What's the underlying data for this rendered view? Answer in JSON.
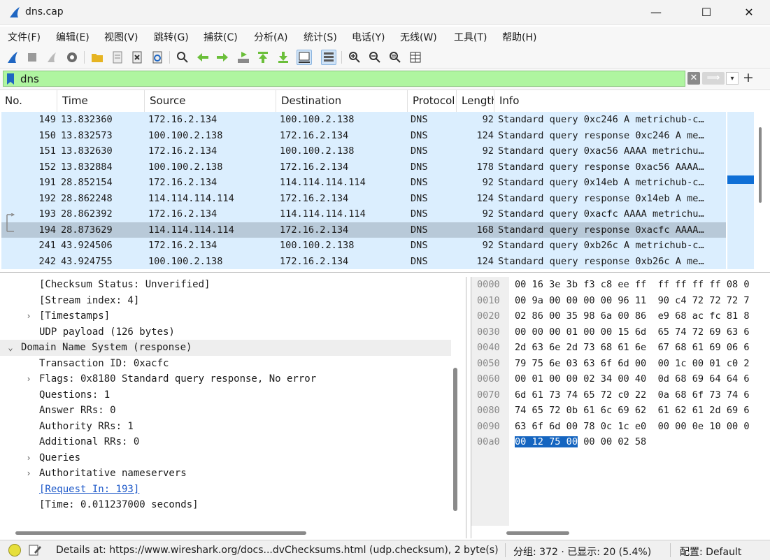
{
  "window": {
    "title": "dns.cap",
    "min": "—",
    "max": "☐",
    "close": "✕"
  },
  "menu": [
    "文件(F)",
    "编辑(E)",
    "视图(V)",
    "跳转(G)",
    "捕获(C)",
    "分析(A)",
    "统计(S)",
    "电话(Y)",
    "无线(W)",
    "工具(T)",
    "帮助(H)"
  ],
  "filter": {
    "value": "dns",
    "clear": "✕",
    "apply": "⟹",
    "dropdown": "▾",
    "add": "+"
  },
  "columns": [
    "No.",
    "Time",
    "Source",
    "Destination",
    "Protocol",
    "Length",
    "Info"
  ],
  "packets": [
    {
      "no": "149",
      "time": "13.832360",
      "src": "172.16.2.134",
      "dst": "100.100.2.138",
      "proto": "DNS",
      "len": "92",
      "info": "Standard query 0xc246 A metrichub-c…"
    },
    {
      "no": "150",
      "time": "13.832573",
      "src": "100.100.2.138",
      "dst": "172.16.2.134",
      "proto": "DNS",
      "len": "124",
      "info": "Standard query response 0xc246 A me…"
    },
    {
      "no": "151",
      "time": "13.832630",
      "src": "172.16.2.134",
      "dst": "100.100.2.138",
      "proto": "DNS",
      "len": "92",
      "info": "Standard query 0xac56 AAAA metrichu…"
    },
    {
      "no": "152",
      "time": "13.832884",
      "src": "100.100.2.138",
      "dst": "172.16.2.134",
      "proto": "DNS",
      "len": "178",
      "info": "Standard query response 0xac56 AAAA…"
    },
    {
      "no": "191",
      "time": "28.852154",
      "src": "172.16.2.134",
      "dst": "114.114.114.114",
      "proto": "DNS",
      "len": "92",
      "info": "Standard query 0x14eb A metrichub-c…"
    },
    {
      "no": "192",
      "time": "28.862248",
      "src": "114.114.114.114",
      "dst": "172.16.2.134",
      "proto": "DNS",
      "len": "124",
      "info": "Standard query response 0x14eb A me…"
    },
    {
      "no": "193",
      "time": "28.862392",
      "src": "172.16.2.134",
      "dst": "114.114.114.114",
      "proto": "DNS",
      "len": "92",
      "info": "Standard query 0xacfc AAAA metrichu…"
    },
    {
      "no": "194",
      "time": "28.873629",
      "src": "114.114.114.114",
      "dst": "172.16.2.134",
      "proto": "DNS",
      "len": "168",
      "info": "Standard query response 0xacfc AAAA…"
    },
    {
      "no": "241",
      "time": "43.924506",
      "src": "172.16.2.134",
      "dst": "100.100.2.138",
      "proto": "DNS",
      "len": "92",
      "info": "Standard query 0xb26c A metrichub-c…"
    },
    {
      "no": "242",
      "time": "43.924755",
      "src": "100.100.2.138",
      "dst": "172.16.2.134",
      "proto": "DNS",
      "len": "124",
      "info": "Standard query response 0xb26c A me…"
    }
  ],
  "details": [
    {
      "text": "[Checksum Status: Unverified]",
      "indent": 2,
      "arrow": ""
    },
    {
      "text": "[Stream index: 4]",
      "indent": 2,
      "arrow": ""
    },
    {
      "text": "[Timestamps]",
      "indent": 2,
      "arrow": "›"
    },
    {
      "text": "UDP payload (126 bytes)",
      "indent": 2,
      "arrow": ""
    },
    {
      "text": "Domain Name System (response)",
      "indent": 1,
      "arrow": "⌄"
    },
    {
      "text": "Transaction ID: 0xacfc",
      "indent": 2,
      "arrow": ""
    },
    {
      "text": "Flags: 0x8180 Standard query response, No error",
      "indent": 2,
      "arrow": "›"
    },
    {
      "text": "Questions: 1",
      "indent": 2,
      "arrow": ""
    },
    {
      "text": "Answer RRs: 0",
      "indent": 2,
      "arrow": ""
    },
    {
      "text": "Authority RRs: 1",
      "indent": 2,
      "arrow": ""
    },
    {
      "text": "Additional RRs: 0",
      "indent": 2,
      "arrow": ""
    },
    {
      "text": "Queries",
      "indent": 2,
      "arrow": "›"
    },
    {
      "text": "Authoritative nameservers",
      "indent": 2,
      "arrow": "›"
    },
    {
      "text": "[Request In: 193]",
      "indent": 2,
      "arrow": ""
    },
    {
      "text": "[Time: 0.011237000 seconds]",
      "indent": 2,
      "arrow": ""
    }
  ],
  "bytes": [
    {
      "offset": "0000",
      "hex": "00 16 3e 3b f3 c8 ee ff  ff ff ff ff 08 0"
    },
    {
      "offset": "0010",
      "hex": "00 9a 00 00 00 00 96 11  90 c4 72 72 72 7"
    },
    {
      "offset": "0020",
      "hex": "02 86 00 35 98 6a 00 86  e9 68 ac fc 81 8"
    },
    {
      "offset": "0030",
      "hex": "00 00 00 01 00 00 15 6d  65 74 72 69 63 6"
    },
    {
      "offset": "0040",
      "hex": "2d 63 6e 2d 73 68 61 6e  67 68 61 69 06 6"
    },
    {
      "offset": "0050",
      "hex": "79 75 6e 03 63 6f 6d 00  00 1c 00 01 c0 2"
    },
    {
      "offset": "0060",
      "hex": "00 01 00 00 02 34 00 40  0d 68 69 64 64 6"
    },
    {
      "offset": "0070",
      "hex": "6d 61 73 74 65 72 c0 22  0a 68 6f 73 74 6"
    },
    {
      "offset": "0080",
      "hex": "74 65 72 0b 61 6c 69 62  61 62 61 2d 69 6"
    },
    {
      "offset": "0090",
      "hex": "63 6f 6d 00 78 0c 1c e0  00 00 0e 10 00 0"
    },
    {
      "offset": "00a0",
      "sel": "00 12 75 00",
      "hex": " 00 00 02 58"
    }
  ],
  "status": {
    "details": "Details at: https://www.wireshark.org/docs...dvChecksums.html (udp.checksum), 2 byte(s)",
    "packets": "分组: 372 · 已显示: 20 (5.4%)",
    "profile": "配置: Default"
  },
  "colors": {
    "row": "#dbeefe",
    "row_selected": "#b8c9d8",
    "filter_ok": "#aff5a0",
    "accent": "#1565c0"
  }
}
